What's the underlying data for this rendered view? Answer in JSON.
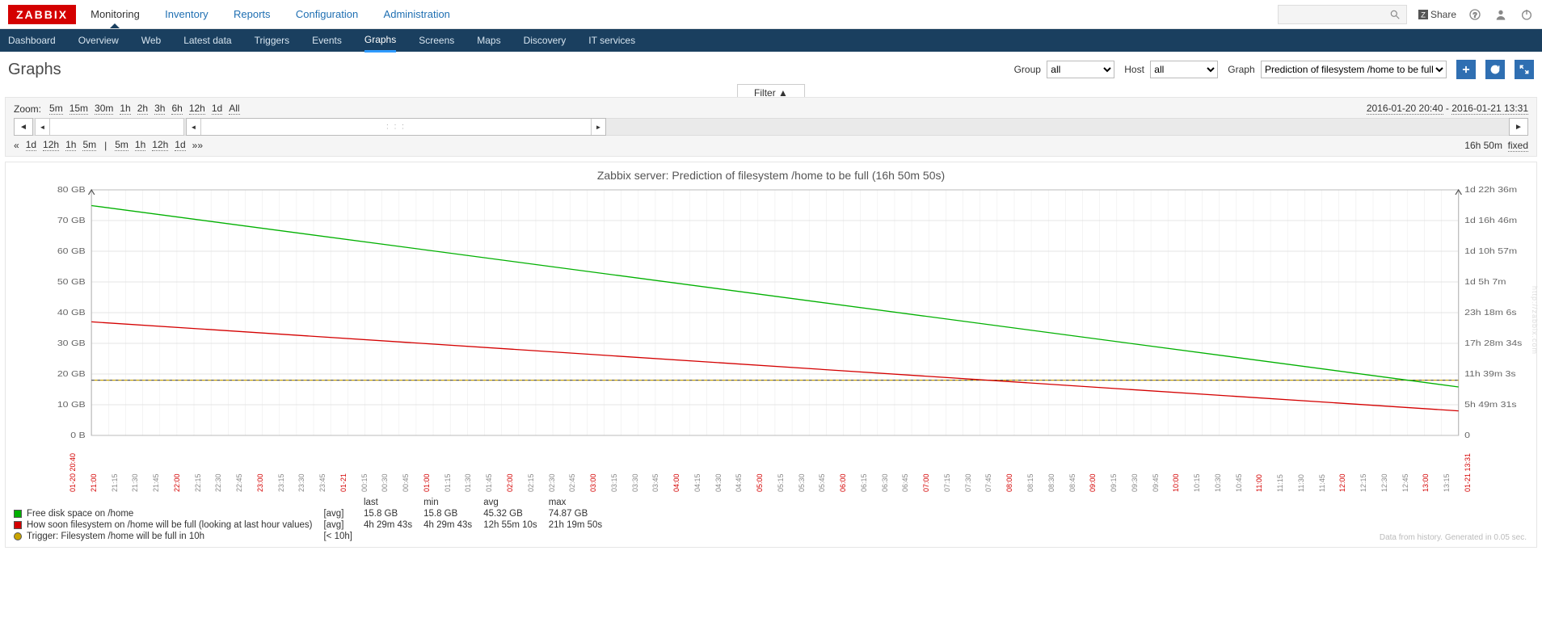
{
  "brand": "ZABBIX",
  "topnav": {
    "monitoring": "Monitoring",
    "inventory": "Inventory",
    "reports": "Reports",
    "configuration": "Configuration",
    "administration": "Administration"
  },
  "subnav": {
    "dashboard": "Dashboard",
    "overview": "Overview",
    "web": "Web",
    "latest": "Latest data",
    "triggers": "Triggers",
    "events": "Events",
    "graphs": "Graphs",
    "screens": "Screens",
    "maps": "Maps",
    "discovery": "Discovery",
    "it": "IT services"
  },
  "share": "Share",
  "page_title": "Graphs",
  "filters": {
    "group_label": "Group",
    "group_value": "all",
    "host_label": "Host",
    "host_value": "all",
    "graph_label": "Graph",
    "graph_value": "Prediction of filesystem /home to be full"
  },
  "filter_toggle": "Filter ▲",
  "zoom": {
    "label": "Zoom:",
    "z5m": "5m",
    "z15m": "15m",
    "z30m": "30m",
    "z1h": "1h",
    "z2h": "2h",
    "z3h": "3h",
    "z6h": "6h",
    "z12h": "12h",
    "z1d": "1d",
    "zall": "All"
  },
  "range": {
    "from": "2016-01-20 20:40",
    "to": "2016-01-21 13:31"
  },
  "nav": {
    "ll": "«",
    "l1d": "1d",
    "l12h": "12h",
    "l1h": "1h",
    "l5m": "5m",
    "sep": "|",
    "r5m": "5m",
    "r1h": "1h",
    "r12h": "12h",
    "r1d": "1d",
    "rr": "»»",
    "dur": "16h 50m",
    "fixed": "fixed"
  },
  "chart": {
    "title": "Zabbix server: Prediction of filesystem /home to be full (16h 50m 50s)",
    "footnote": "Data from history. Generated in 0.05 sec.",
    "watermark": "http://zabbix.com"
  },
  "chart_data": {
    "type": "line",
    "x_start": "2016-01-20 20:40",
    "x_end": "2016-01-21 13:31",
    "y_left_label": "",
    "y_left_unit": "GB",
    "y_left_ticks": [
      "0 B",
      "10 GB",
      "20 GB",
      "30 GB",
      "40 GB",
      "50 GB",
      "60 GB",
      "70 GB",
      "80 GB"
    ],
    "y_left_range": [
      0,
      80
    ],
    "y_right_label": "",
    "y_right_ticks": [
      "0",
      "5h 49m 31s",
      "11h 39m 3s",
      "17h 28m 34s",
      "23h 18m 6s",
      "1d 5h 7m",
      "1d 10h 57m",
      "1d 16h 46m",
      "1d 22h 36m"
    ],
    "trigger_line_gb": 18,
    "series": [
      {
        "name": "Free disk space on /home",
        "color": "#00b000",
        "axis": "left",
        "sample_values_gb": [
          74.87,
          15.8
        ]
      },
      {
        "name": "How soon filesystem on /home will be full (looking at last hour values)",
        "color": "#d40000",
        "axis": "right",
        "sample_values_sec": [
          76790,
          16183
        ]
      }
    ],
    "x_ticks": [
      {
        "t": "01-20 20:40",
        "major": true
      },
      {
        "t": "21:00",
        "major": true
      },
      {
        "t": "21:15"
      },
      {
        "t": "21:30"
      },
      {
        "t": "21:45"
      },
      {
        "t": "22:00",
        "major": true
      },
      {
        "t": "22:15"
      },
      {
        "t": "22:30"
      },
      {
        "t": "22:45"
      },
      {
        "t": "23:00",
        "major": true
      },
      {
        "t": "23:15"
      },
      {
        "t": "23:30"
      },
      {
        "t": "23:45"
      },
      {
        "t": "01-21",
        "major": true
      },
      {
        "t": "00:15"
      },
      {
        "t": "00:30"
      },
      {
        "t": "00:45"
      },
      {
        "t": "01:00",
        "major": true
      },
      {
        "t": "01:15"
      },
      {
        "t": "01:30"
      },
      {
        "t": "01:45"
      },
      {
        "t": "02:00",
        "major": true
      },
      {
        "t": "02:15"
      },
      {
        "t": "02:30"
      },
      {
        "t": "02:45"
      },
      {
        "t": "03:00",
        "major": true
      },
      {
        "t": "03:15"
      },
      {
        "t": "03:30"
      },
      {
        "t": "03:45"
      },
      {
        "t": "04:00",
        "major": true
      },
      {
        "t": "04:15"
      },
      {
        "t": "04:30"
      },
      {
        "t": "04:45"
      },
      {
        "t": "05:00",
        "major": true
      },
      {
        "t": "05:15"
      },
      {
        "t": "05:30"
      },
      {
        "t": "05:45"
      },
      {
        "t": "06:00",
        "major": true
      },
      {
        "t": "06:15"
      },
      {
        "t": "06:30"
      },
      {
        "t": "06:45"
      },
      {
        "t": "07:00",
        "major": true
      },
      {
        "t": "07:15"
      },
      {
        "t": "07:30"
      },
      {
        "t": "07:45"
      },
      {
        "t": "08:00",
        "major": true
      },
      {
        "t": "08:15"
      },
      {
        "t": "08:30"
      },
      {
        "t": "08:45"
      },
      {
        "t": "09:00",
        "major": true
      },
      {
        "t": "09:15"
      },
      {
        "t": "09:30"
      },
      {
        "t": "09:45"
      },
      {
        "t": "10:00",
        "major": true
      },
      {
        "t": "10:15"
      },
      {
        "t": "10:30"
      },
      {
        "t": "10:45"
      },
      {
        "t": "11:00",
        "major": true
      },
      {
        "t": "11:15"
      },
      {
        "t": "11:30"
      },
      {
        "t": "11:45"
      },
      {
        "t": "12:00",
        "major": true
      },
      {
        "t": "12:15"
      },
      {
        "t": "12:30"
      },
      {
        "t": "12:45"
      },
      {
        "t": "13:00",
        "major": true
      },
      {
        "t": "13:15"
      },
      {
        "t": "01-21 13:31",
        "major": true
      }
    ]
  },
  "legend": {
    "headers": {
      "last": "last",
      "min": "min",
      "avg": "avg",
      "max": "max"
    },
    "rows": [
      {
        "swatch": "#00b000",
        "name": "Free disk space on /home",
        "agg": "[avg]",
        "last": "15.8 GB",
        "min": "15.8 GB",
        "avg": "45.32 GB",
        "max": "74.87 GB"
      },
      {
        "swatch": "#d40000",
        "name": "How soon filesystem on /home will be full (looking at last hour values)",
        "agg": "[avg]",
        "last": "4h 29m 43s",
        "min": "4h 29m 43s",
        "avg": "12h 55m 10s",
        "max": "21h 19m 50s"
      }
    ],
    "trigger": {
      "swatch": "#c9a400",
      "name": "Trigger: Filesystem /home will be full in 10h",
      "cond": "[< 10h]"
    }
  }
}
